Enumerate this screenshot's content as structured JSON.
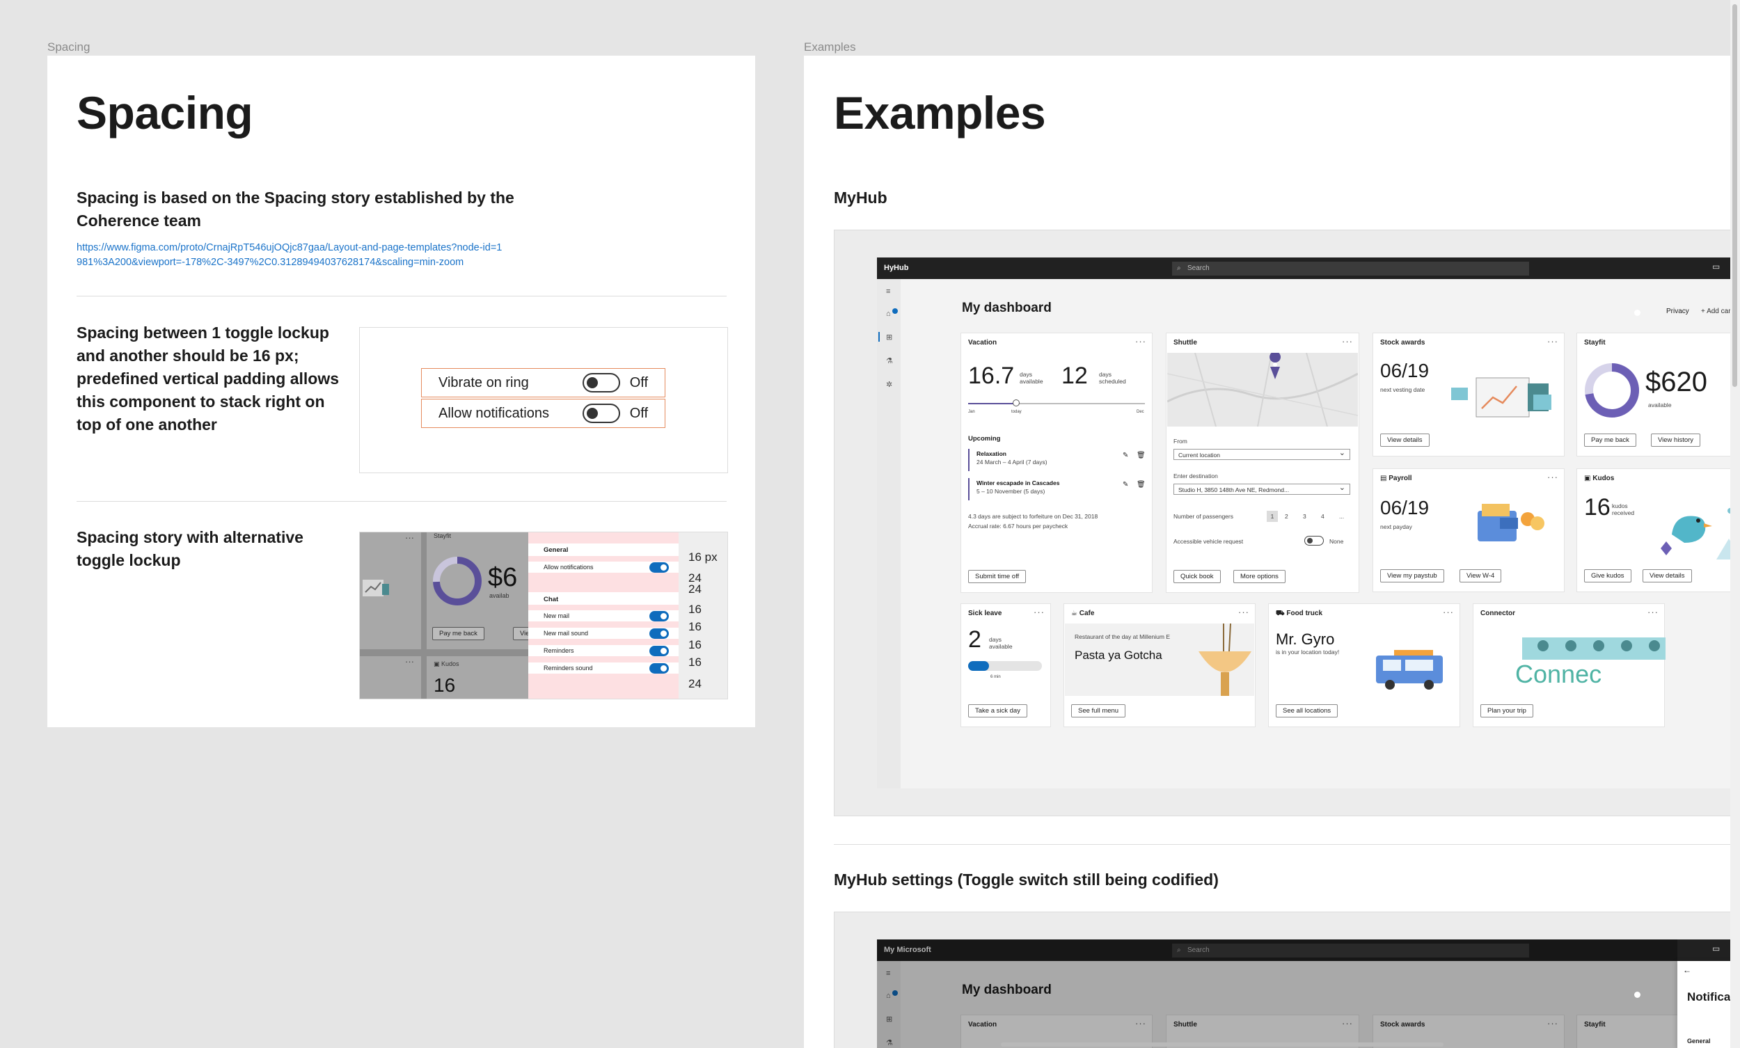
{
  "canvas": {
    "bg": "#e5e5e5",
    "accent": "#0f6cbd",
    "highlight": "#e58a5c"
  },
  "spacing_frame": {
    "label": "Spacing",
    "title": "Spacing",
    "intro_title": "Spacing is based on the Spacing story established by the Coherence team",
    "link_line1": "https://www.figma.com/proto/CrnajRpT546ujOQjc87gaa/Layout-and-page-templates?node-id=1",
    "link_line2": "981%3A200&viewport=-178%2C-3497%2C0.31289494037628174&scaling=min-zoom",
    "toggle_section_title": "Spacing between 1 toggle lockup and another should be 16 px; predefined vertical padding allows this component to stack right on top of one another",
    "toggles": [
      {
        "label": "Vibrate on ring",
        "state": "Off"
      },
      {
        "label": "Allow notifications",
        "state": "Off"
      }
    ],
    "alt_section_title": "Spacing story with alternative toggle lockup",
    "alt_demo": {
      "stayfit": "Stayfit",
      "amount": "$6",
      "available": "availab",
      "pay_me_back": "Pay me back",
      "view": "View",
      "kudos": "Kudos",
      "kudos_num": "16",
      "general": "General",
      "allow_notifications": "Allow notifications",
      "chat": "Chat",
      "new_mail": "New mail",
      "new_mail_sound": "New mail sound",
      "reminders": "Reminders",
      "reminders_sound": "Reminders sound",
      "dims": [
        "16 px",
        "24",
        "24",
        "16",
        "16",
        "16",
        "16",
        "24"
      ]
    }
  },
  "examples_frame": {
    "label": "Examples",
    "title": "Examples",
    "myhub_heading": "MyHub",
    "settings_heading": "MyHub settings (Toggle switch still being codified)",
    "app": {
      "name": "HyHub",
      "search": "Search",
      "dashboard_title": "My dashboard",
      "privacy": "Privacy",
      "add_card": "+ Add card",
      "vacation": {
        "title": "Vacation",
        "days_available": "16.7",
        "available_label": "days available",
        "days_scheduled": "12",
        "scheduled_label": "days scheduled",
        "slider_start": "Jan",
        "slider_today": "today",
        "slider_end": "Dec",
        "upcoming": "Upcoming",
        "items": [
          {
            "name": "Relaxation",
            "dates": "24 March – 4 April (7 days)"
          },
          {
            "name": "Winter escapade in Cascades",
            "dates": "5 – 10 November (5 days)"
          }
        ],
        "forfeit": "4.3 days are subject to forfeiture on Dec 31, 2018",
        "accrual": "Accrual rate: 6.67 hours per paycheck",
        "button": "Submit time off"
      },
      "shuttle": {
        "title": "Shuttle",
        "from_label": "From",
        "from_value": "Current location",
        "dest_label": "Enter destination",
        "dest_value": "Studio H, 3850 148th Ave NE, Redmond...",
        "passengers_label": "Number of passengers",
        "passengers": [
          "1",
          "2",
          "3",
          "4",
          "..."
        ],
        "accessible_label": "Accessible vehicle request",
        "accessible_value": "None",
        "quick_book": "Quick book",
        "more_options": "More options"
      },
      "stock": {
        "title": "Stock awards",
        "date": "06/19",
        "sub": "next vesting date",
        "button": "View details"
      },
      "stayfit": {
        "title": "Stayfit",
        "amount": "$620",
        "sub": "available",
        "pay_me_back": "Pay me back",
        "view_history": "View history"
      },
      "payroll": {
        "title": "Payroll",
        "date": "06/19",
        "sub": "next payday",
        "view_paystub": "View my paystub",
        "view_w4": "View W-4"
      },
      "kudos": {
        "title": "Kudos",
        "count": "16",
        "sub": "kudos received",
        "give": "Give kudos",
        "details": "View details"
      },
      "sick": {
        "title": "Sick leave",
        "days": "2",
        "sub": "days available",
        "min": "6 min",
        "button": "Take a sick day"
      },
      "cafe": {
        "title": "Cafe",
        "restaurant": "Restaurant of the day at Millenium E",
        "dish": "Pasta ya Gotcha",
        "button": "See full menu"
      },
      "food_truck": {
        "title": "Food truck",
        "name": "Mr. Gyro",
        "sub": "is in your location today!",
        "button": "See all locations"
      },
      "connector": {
        "title": "Connector",
        "logo": "Connec",
        "button": "Plan your trip"
      }
    },
    "settings_app": {
      "name": "My Microsoft",
      "search": "Search",
      "dashboard_title": "My dashboard",
      "cards": [
        "Vacation",
        "Shuttle",
        "Stock awards",
        "Stayfit"
      ],
      "panel_title": "Notificat",
      "panel_section": "General"
    }
  }
}
